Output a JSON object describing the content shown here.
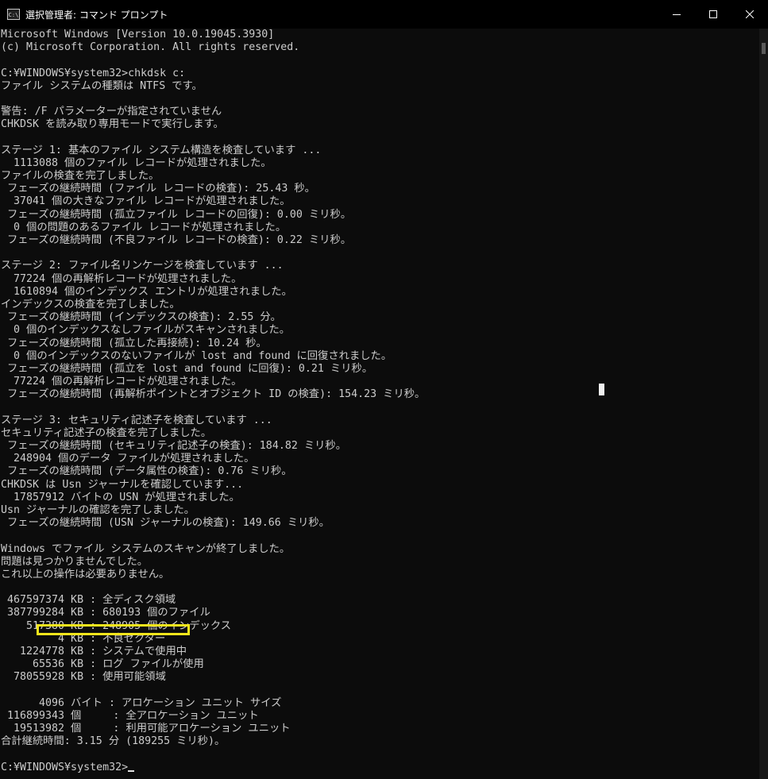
{
  "window": {
    "title": "選択管理者: コマンド プロンプト",
    "icon_label": "C:\\",
    "controls": [
      "minimize-icon",
      "maximize-icon",
      "close-icon"
    ]
  },
  "colors": {
    "background": "#0c0c0c",
    "text": "#cccccc",
    "highlight": "#f2e51c"
  },
  "console": {
    "lines": [
      "Microsoft Windows [Version 10.0.19045.3930]",
      "(c) Microsoft Corporation. All rights reserved.",
      "",
      "C:¥WINDOWS¥system32>chkdsk c:",
      "ファイル システムの種類は NTFS です。",
      "",
      "警告: /F パラメーターが指定されていません",
      "CHKDSK を読み取り専用モードで実行します。",
      "",
      "ステージ 1: 基本のファイル システム構造を検査しています ...",
      "  1113088 個のファイル レコードが処理されました。",
      "ファイルの検査を完了しました。",
      " フェーズの継続時間 (ファイル レコードの検査): 25.43 秒。",
      "  37041 個の大きなファイル レコードが処理されました。",
      " フェーズの継続時間 (孤立ファイル レコードの回復): 0.00 ミリ秒。",
      "  0 個の問題のあるファイル レコードが処理されました。",
      " フェーズの継続時間 (不良ファイル レコードの検査): 0.22 ミリ秒。",
      "",
      "ステージ 2: ファイル名リンケージを検査しています ...",
      "  77224 個の再解析レコードが処理されました。",
      "  1610894 個のインデックス エントリが処理されました。",
      "インデックスの検査を完了しました。",
      " フェーズの継続時間 (インデックスの検査): 2.55 分。",
      "  0 個のインデックスなしファイルがスキャンされました。",
      " フェーズの継続時間 (孤立した再接続): 10.24 秒。",
      "  0 個のインデックスのないファイルが lost and found に回復されました。",
      " フェーズの継続時間 (孤立を lost and found に回復): 0.21 ミリ秒。",
      "  77224 個の再解析レコードが処理されました。",
      " フェーズの継続時間 (再解析ポイントとオブジェクト ID の検査): 154.23 ミリ秒。",
      "",
      "ステージ 3: セキュリティ記述子を検査しています ...",
      "セキュリティ記述子の検査を完了しました。",
      " フェーズの継続時間 (セキュリティ記述子の検査): 184.82 ミリ秒。",
      "  248904 個のデータ ファイルが処理されました。",
      " フェーズの継続時間 (データ属性の検査): 0.76 ミリ秒。",
      "CHKDSK は Usn ジャーナルを確認しています...",
      "  17857912 バイトの USN が処理されました。",
      "Usn ジャーナルの確認を完了しました。",
      " フェーズの継続時間 (USN ジャーナルの検査): 149.66 ミリ秒。",
      "",
      "Windows でファイル システムのスキャンが終了しました。",
      "問題は見つかりませんでした。",
      "これ以上の操作は必要ありません。",
      "",
      " 467597374 KB : 全ディスク領域",
      " 387799284 KB : 680193 個のファイル",
      "    517380 KB : 248905 個のインデックス",
      "         4 KB : 不良セクター",
      "   1224778 KB : システムで使用中",
      "     65536 KB : ログ ファイルが使用",
      "  78055928 KB : 使用可能領域",
      "",
      "      4096 バイト : アロケーション ユニット サイズ",
      " 116899343 個     : 全アロケーション ユニット",
      "  19513982 個     : 利用可能アロケーション ユニット",
      "合計継続時間: 3.15 分 (189255 ミリ秒)。",
      "",
      "C:¥WINDOWS¥system32>"
    ]
  }
}
